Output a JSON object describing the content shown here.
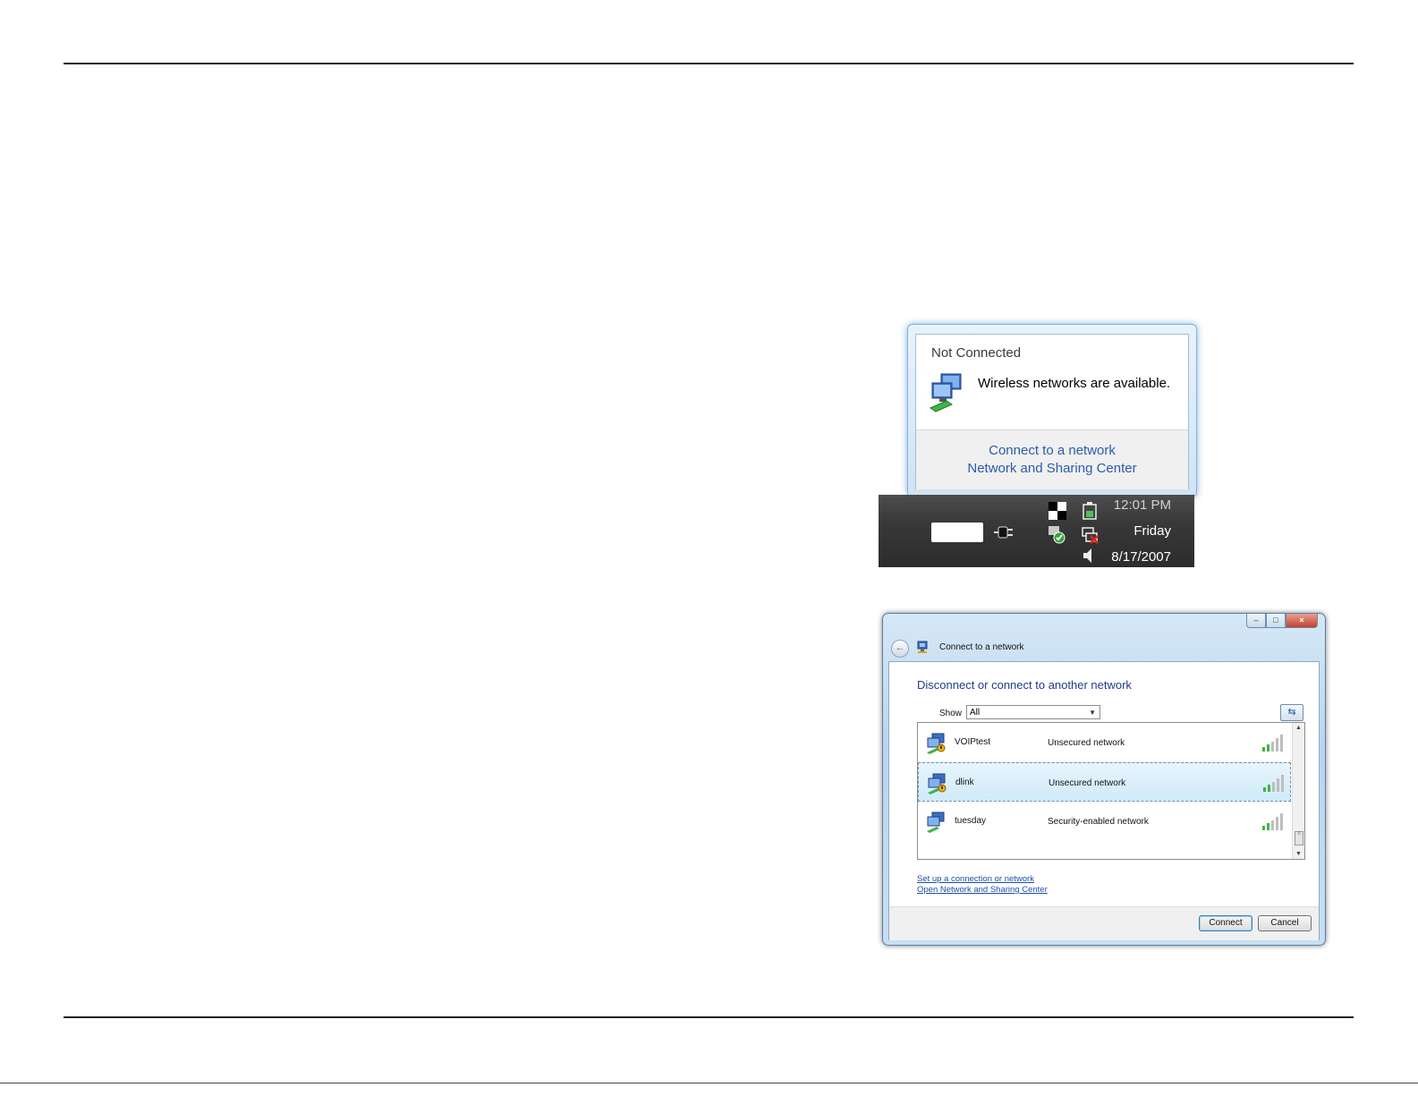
{
  "tray_popup": {
    "status": "Not Connected",
    "message": "Wireless networks are available.",
    "links": [
      "Connect to a network",
      "Network and Sharing Center"
    ],
    "icons": {
      "network": "network-computers-icon"
    }
  },
  "taskbar": {
    "time": "12:01 PM",
    "day": "Friday",
    "date": "8/17/2007",
    "icons": [
      "power-plug-icon",
      "tray-app-icon",
      "security-shield-icon",
      "battery-icon",
      "network-disconnected-icon",
      "speaker-icon"
    ]
  },
  "connect_window": {
    "title": "Connect to a network",
    "heading": "Disconnect or connect to another network",
    "show_label": "Show",
    "show_value": "All",
    "networks": [
      {
        "name": "VOIPtest",
        "security": "Unsecured network",
        "signal_bars": 5,
        "selected": false
      },
      {
        "name": "dlink",
        "security": "Unsecured network",
        "signal_bars": 5,
        "selected": true
      },
      {
        "name": "tuesday",
        "security": "Security-enabled network",
        "signal_bars": 5,
        "selected": false
      }
    ],
    "links": [
      "Set up a connection or network",
      "Open Network and Sharing Center"
    ],
    "buttons": {
      "connect": "Connect",
      "cancel": "Cancel"
    },
    "controls": {
      "minimize": "–",
      "maximize": "□",
      "close": "×",
      "back": "←",
      "refresh": "⇆"
    }
  },
  "colors": {
    "link_blue": "#2a5cab",
    "heading_blue": "#1f3c8a",
    "selection": "#cfeaf9"
  }
}
